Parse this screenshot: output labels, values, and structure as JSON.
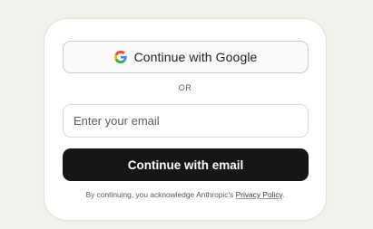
{
  "auth": {
    "google_button_label": "Continue with Google",
    "divider_text": "OR",
    "email_placeholder": "Enter your email",
    "email_value": "",
    "email_button_label": "Continue with email",
    "legal_prefix": "By continuing, you acknowledge Anthropic's ",
    "privacy_link_label": "Privacy Policy",
    "legal_suffix": "."
  },
  "icons": {
    "google": "google-g-logo"
  },
  "colors": {
    "page_background": "#f3f1ec",
    "card_background": "#ffffff",
    "primary_button": "#171614",
    "google_blue": "#4285F4",
    "google_red": "#EA4335",
    "google_yellow": "#FBBC05",
    "google_green": "#34A853"
  }
}
